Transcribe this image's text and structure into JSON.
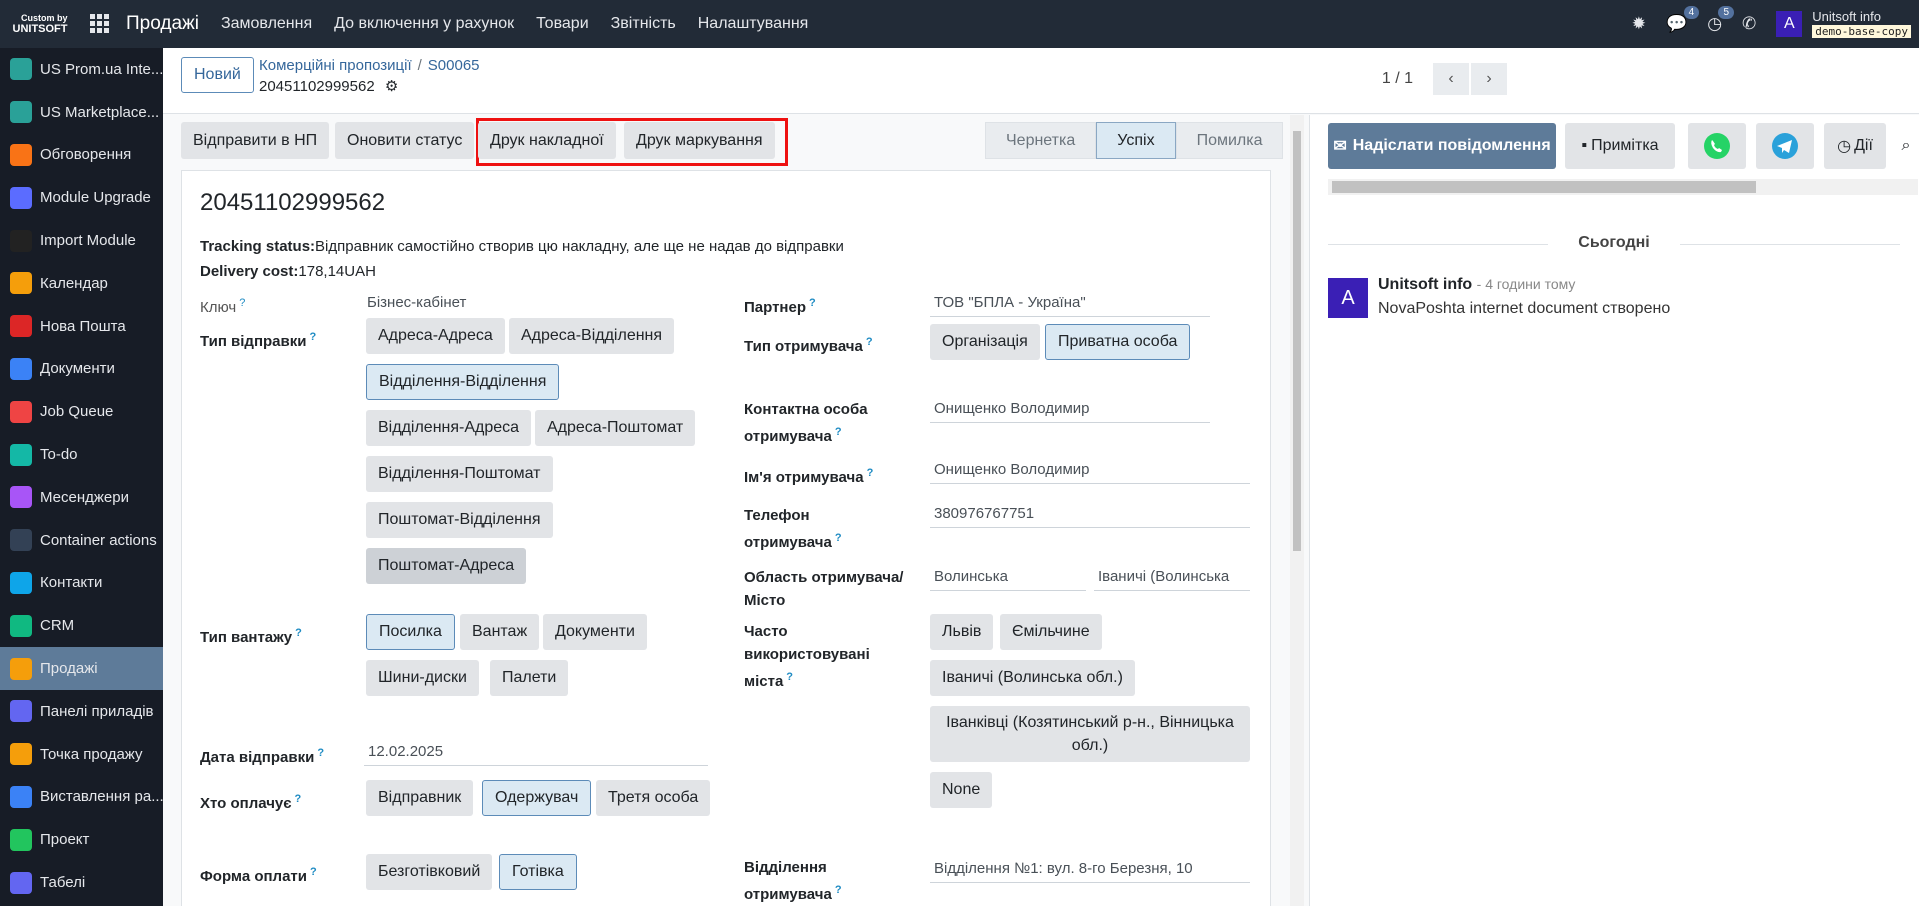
{
  "topbar": {
    "logo_line1": "Custom by",
    "logo_line2": "UNITSOFT",
    "app_name": "Продажі",
    "menu": [
      "Замовлення",
      "До включення у рахунок",
      "Товари",
      "Звітність",
      "Налаштування"
    ],
    "chat_count": "4",
    "activity_count": "5",
    "avatar_letter": "A",
    "user_name": "Unitsoft info",
    "db_name": "demo-base-copy"
  },
  "sidebar": {
    "items": [
      {
        "label": "US Prom.ua Inte...",
        "color": "#2aa198"
      },
      {
        "label": "US Marketplace...",
        "color": "#2aa198"
      },
      {
        "label": "Обговорення",
        "color": "#f97316"
      },
      {
        "label": "Module Upgrade",
        "color": "#5b6cff"
      },
      {
        "label": "Import Module",
        "color": "#222"
      },
      {
        "label": "Календар",
        "color": "#f59e0b"
      },
      {
        "label": "Нова Пошта",
        "color": "#dc2626"
      },
      {
        "label": "Документи",
        "color": "#3b82f6"
      },
      {
        "label": "Job Queue",
        "color": "#ef4444"
      },
      {
        "label": "To-do",
        "color": "#14b8a6"
      },
      {
        "label": "Месенджери",
        "color": "#a855f7"
      },
      {
        "label": "Container actions",
        "color": "#334155"
      },
      {
        "label": "Контакти",
        "color": "#0ea5e9"
      },
      {
        "label": "CRM",
        "color": "#10b981"
      },
      {
        "label": "Продажі",
        "color": "#f59e0b"
      },
      {
        "label": "Панелі приладів",
        "color": "#6366f1"
      },
      {
        "label": "Точка продажу",
        "color": "#f59e0b"
      },
      {
        "label": "Виставлення ра...",
        "color": "#3b82f6"
      },
      {
        "label": "Проект",
        "color": "#22c55e"
      },
      {
        "label": "Табелі",
        "color": "#6366f1"
      }
    ],
    "active_index": 14
  },
  "control": {
    "new_button": "Новий",
    "breadcrumb_parent": "Комерційні пропозиції",
    "breadcrumb_sep": "/",
    "breadcrumb_current": "S00065",
    "record_name": "20451102999562",
    "pager": "1 / 1"
  },
  "header_buttons": {
    "send_np": "Відправити в НП",
    "update_status": "Оновити статус",
    "print_invoice": "Друк накладної",
    "print_marking": "Друк маркування"
  },
  "statusbar": [
    "Чернетка",
    "Успіх",
    "Помилка"
  ],
  "statusbar_active": "Успіх",
  "form": {
    "title": "20451102999562",
    "tracking_label": "Tracking status:",
    "tracking_value": "Відправник самостійно створив цю накладну, але ще не надав до відправки",
    "delivery_label": "Delivery cost:",
    "delivery_value": "178,14UAH",
    "key_label": "Ключ",
    "key_value": "Бізнес-кабінет",
    "ship_type_label": "Тип відправки",
    "ship_types": [
      "Адреса-Адреса",
      "Адреса-Відділення",
      "Відділення-Відділення",
      "Відділення-Адреса",
      "Адреса-Поштомат",
      "Відділення-Поштомат",
      "Поштомат-Відділення",
      "Поштомат-Адреса"
    ],
    "cargo_label": "Тип вантажу",
    "cargo_types": [
      "Посилка",
      "Вантаж",
      "Документи",
      "Шини-диски",
      "Палети"
    ],
    "date_label": "Дата відправки",
    "date_value": "12.02.2025",
    "payer_label": "Хто оплачує",
    "payers": [
      "Відправник",
      "Одержувач",
      "Третя особа"
    ],
    "payment_label": "Форма оплати",
    "payments": [
      "Безготівковий",
      "Готівка"
    ],
    "partner_label": "Партнер",
    "partner_value": "ТОВ \"БПЛА - Україна\"",
    "recipient_type_label": "Тип отримувача",
    "recipient_types": [
      "Організація",
      "Приватна особа"
    ],
    "contact_label_1": "Контактна особа",
    "contact_label_2": "отримувача",
    "contact_value": "Онищенко Володимир",
    "recipient_name_label": "Ім'я отримувача",
    "recipient_name_value": "Онищенко Володимир",
    "phone_label_1": "Телефон",
    "phone_label_2": "отримувача",
    "phone_value": "380976767751",
    "region_label_1": "Область отримувача/",
    "region_label_2": "Місто",
    "region_value": "Волинська",
    "city_value": "Іваничі (Волинська",
    "frequent_label_1": "Часто",
    "frequent_label_2": "використовувані",
    "frequent_label_3": "міста",
    "frequent_cities": [
      "Львів",
      "Ємільчине",
      "Іваничі (Волинська обл.)",
      "Іванківці (Козятинський р-н., Вінницька обл.)",
      "None"
    ],
    "branch_label_1": "Відділення",
    "branch_label_2": "отримувача",
    "branch_value": "Відділення №1: вул. 8-го Березня, 10"
  },
  "chatter": {
    "send_message": "Надіслати повідомлення",
    "note": "Примітка",
    "actions": "Дії",
    "today": "Сьогодні",
    "author": "Unitsoft info",
    "time": "- 4 години тому",
    "body": "NovaPoshta internet document створено",
    "avatar_letter": "A"
  }
}
